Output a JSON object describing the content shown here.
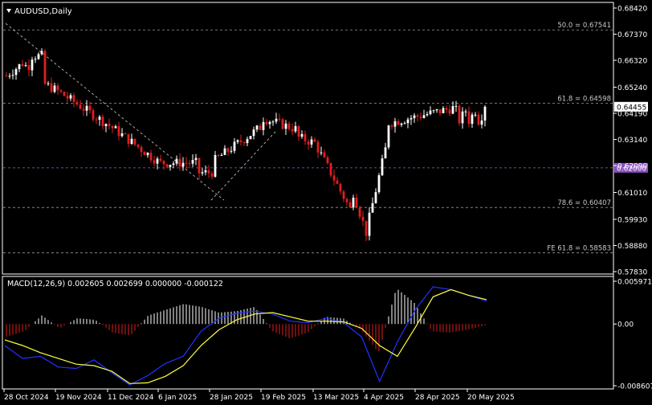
{
  "header": {
    "symbol": "AUDUSD,Daily",
    "dropdown_icon": "triangle-down-icon"
  },
  "macd_header": "MACD(12,26,9) 0.002605 0.002699 0.000000 -0.000122",
  "colors": {
    "background": "#000000",
    "grid": "#3a3a3a",
    "axis": "#ffffff",
    "bull": "#ffffff",
    "bear": "#e01e1e",
    "fib_line": "#9a9a9a",
    "support": "#a060c0",
    "macd_blue": "#2233ff",
    "signal_yellow": "#ffff40",
    "hist_pos": "#ffffff",
    "hist_neg": "#e01e1e",
    "price_label_bg": "#ffffff",
    "support_label_bg": "#8a4fbf"
  },
  "price_axis": {
    "ticks": [
      "0.68420",
      "0.67370",
      "0.66320",
      "0.65240",
      "0.64190",
      "0.63140",
      "0.62090",
      "0.61010",
      "0.59930",
      "0.58880",
      "0.57830"
    ],
    "current_price": "0.64455",
    "support_label": "0.62000"
  },
  "fib_levels": [
    {
      "label": "50.0 = 0.67541",
      "value": 0.67541,
      "style": "dashed"
    },
    {
      "label": "61.8 = 0.64598",
      "value": 0.64598,
      "style": "dashed"
    },
    {
      "label": "78.6 = 0.60407",
      "value": 0.60407,
      "style": "dashed"
    },
    {
      "label": "FE 61.8 = 0.58583",
      "value": 0.58583,
      "style": "dashed"
    }
  ],
  "macd_axis": {
    "ticks": [
      "0.005971",
      "0.00",
      "-0.008607"
    ]
  },
  "time_axis": {
    "labels": [
      "28 Oct 2024",
      "19 Nov 2024",
      "11 Dec 2024",
      "6 Jan 2025",
      "28 Jan 2025",
      "19 Feb 2025",
      "13 Mar 2025",
      "4 Apr 2025",
      "28 Apr 2025",
      "20 May 2025"
    ]
  },
  "chart_data": [
    {
      "type": "candlestick",
      "title": "AUDUSD,Daily",
      "ylim": [
        0.5783,
        0.6842
      ],
      "horizontal_levels": [
        {
          "value": 0.67541,
          "name": "50.0"
        },
        {
          "value": 0.64598,
          "name": "61.8"
        },
        {
          "value": 0.62,
          "name": "support"
        },
        {
          "value": 0.60407,
          "name": "78.6"
        },
        {
          "value": 0.58583,
          "name": "FE 61.8"
        }
      ],
      "trendlines": [
        {
          "from": [
            "28 Oct 2024",
            0.678
          ],
          "to": [
            "28 Jan 2025",
            0.607
          ]
        },
        {
          "from": [
            "28 Jan 2025",
            0.607
          ],
          "to": [
            "19 Feb 2025",
            0.6345
          ]
        }
      ],
      "anchor_dates": [
        "28 Oct 2024",
        "19 Nov 2024",
        "11 Dec 2024",
        "6 Jan 2025",
        "28 Jan 2025",
        "19 Feb 2025",
        "13 Mar 2025",
        "4 Apr 2025",
        "28 Apr 2025",
        "20 May 2025"
      ],
      "anchor_closes": [
        0.662,
        0.651,
        0.637,
        0.622,
        0.622,
        0.637,
        0.63,
        0.592,
        0.64,
        0.642
      ],
      "last_close": 0.64455
    },
    {
      "type": "line+bar",
      "title": "MACD(12,26,9)",
      "ylim": [
        -0.008607,
        0.005971
      ],
      "series": [
        {
          "name": "MACD",
          "values": [
            -0.003,
            -0.0048,
            -0.0045,
            -0.006,
            -0.0062,
            -0.005,
            -0.0068,
            -0.0085,
            -0.0072,
            -0.0055,
            -0.0045,
            -0.001,
            0.0008,
            0.0015,
            0.0018,
            0.0014,
            0.0004,
            0.0002,
            0.0008,
            0.0002,
            -0.0018,
            -0.008,
            -0.0025,
            0.002,
            0.0052,
            0.0048,
            0.004,
            0.0032
          ]
        },
        {
          "name": "Signal",
          "values": [
            -0.0022,
            -0.003,
            -0.004,
            -0.0048,
            -0.0056,
            -0.0058,
            -0.0066,
            -0.0083,
            -0.0082,
            -0.0073,
            -0.0058,
            -0.003,
            -0.0008,
            0.0006,
            0.0014,
            0.0016,
            0.001,
            0.0004,
            0.0004,
            0.0003,
            -0.0006,
            -0.003,
            -0.0045,
            -0.0005,
            0.0038,
            0.0048,
            0.004,
            0.0034
          ]
        }
      ],
      "histogram_sketch": [
        -0.0018,
        -0.001,
        0.0012,
        -0.0006,
        0.0008,
        0.0006,
        -0.0012,
        -0.0016,
        0.0012,
        0.002,
        0.0028,
        0.0024,
        0.0016,
        0.0018,
        0.0024,
        -0.001,
        -0.002,
        -0.0012,
        0.001,
        0.0008,
        -0.0008,
        -0.004,
        0.005,
        0.003,
        -0.001,
        -0.0012,
        -0.0008,
        -0.0002
      ]
    }
  ]
}
